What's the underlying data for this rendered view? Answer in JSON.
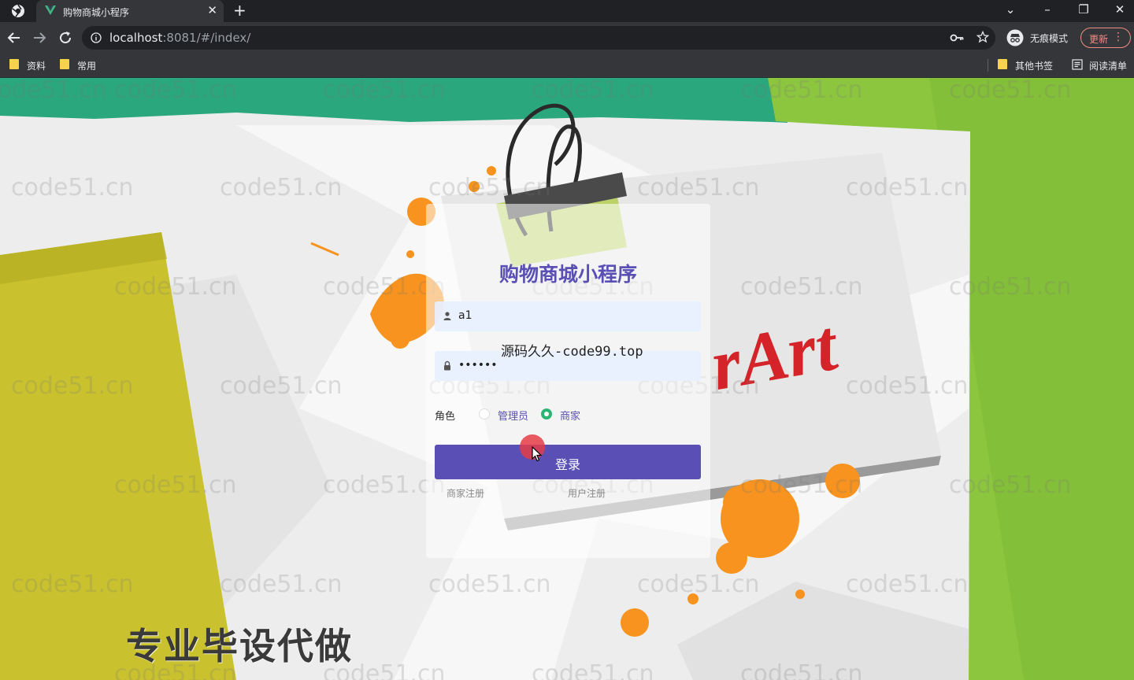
{
  "browser": {
    "tab_title": "购物商城小程序",
    "url_host": "localhost",
    "url_rest": ":8081/#/index/",
    "incognito_label": "无痕模式",
    "update_label": "更新",
    "bookmarks": [
      "资料",
      "常用"
    ],
    "other_bookmarks": "其他书签",
    "reading_list": "阅读清单"
  },
  "login": {
    "title": "购物商城小程序",
    "username_value": "a1",
    "password_value": "••••••",
    "role_label": "角色",
    "roles": [
      "管理员",
      "商家"
    ],
    "selected_role": "商家",
    "login_button": "登录",
    "links": [
      "商家注册",
      "用户注册"
    ]
  },
  "overlay_watermark": "源码久久-code99.top",
  "watermark_text": "code51.cn",
  "bottom_banner": "专业毕设代做",
  "art_text": "rArt",
  "colors": {
    "accent": "#5a4fb4",
    "radio_selected": "#2bb573",
    "orange_splash": "#f7931e",
    "teal_top": "#2aa77d",
    "green_right": "#8cc63f",
    "yellow_left": "#c9c22e"
  }
}
